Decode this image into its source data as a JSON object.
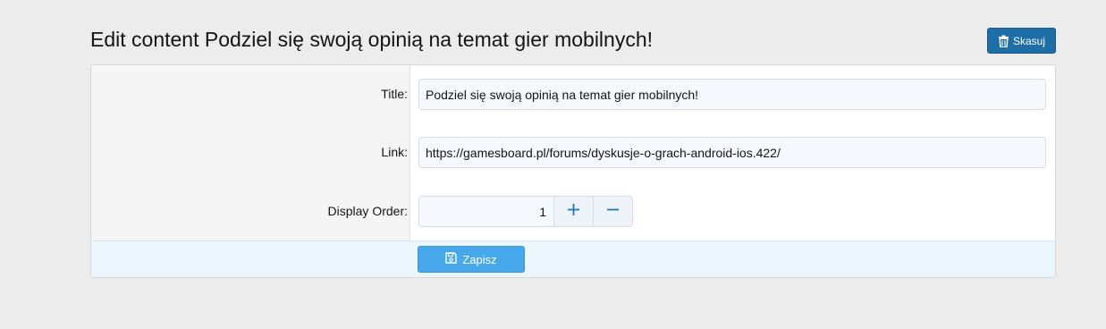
{
  "header": {
    "title": "Edit content Podziel się swoją opinią na temat gier mobilnych!",
    "delete_label": "Skasuj"
  },
  "form": {
    "title_label": "Title:",
    "title_value": "Podziel się swoją opinią na temat gier mobilnych!",
    "link_label": "Link:",
    "link_value": "https://gamesboard.pl/forums/dyskusje-o-grach-android-ios.422/",
    "order_label": "Display Order:",
    "order_value": "1",
    "save_label": "Zapisz"
  },
  "icons": {
    "delete": "trash-icon",
    "increment": "plus-icon",
    "decrement": "minus-icon",
    "save": "floppy-disk-icon"
  },
  "colors": {
    "primary_button": "#47a7eb",
    "delete_button": "#1e6fa8",
    "accent": "#2577b1"
  }
}
